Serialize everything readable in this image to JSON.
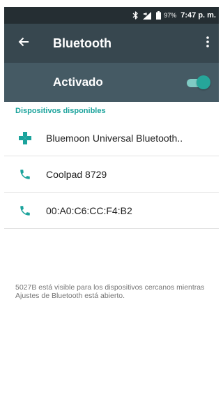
{
  "status_bar": {
    "battery": "97%",
    "time": "7:47 p. m."
  },
  "app_bar": {
    "title": "Bluetooth",
    "back_icon": "arrow-back-icon",
    "menu_icon": "more-vert-icon"
  },
  "switch_bar": {
    "label": "Activado",
    "enabled": true
  },
  "available_devices": {
    "header": "Dispositivos disponibles",
    "items": [
      {
        "name": "Bluemoon Universal Bluetooth..",
        "icon": "gamepad-icon"
      },
      {
        "name": "Coolpad 8729",
        "icon": "phone-icon"
      },
      {
        "name": "00:A0:C6:CC:F4:B2",
        "icon": "phone-icon"
      }
    ]
  },
  "footer": {
    "visibility_text": "5027B está visible para los dispositivos cercanos mientras Ajustes de Bluetooth está abierto."
  },
  "colors": {
    "status_bar": "#252e33",
    "app_bar": "#37474f",
    "switch_bar": "#455a64",
    "accent": "#1ba39c"
  }
}
